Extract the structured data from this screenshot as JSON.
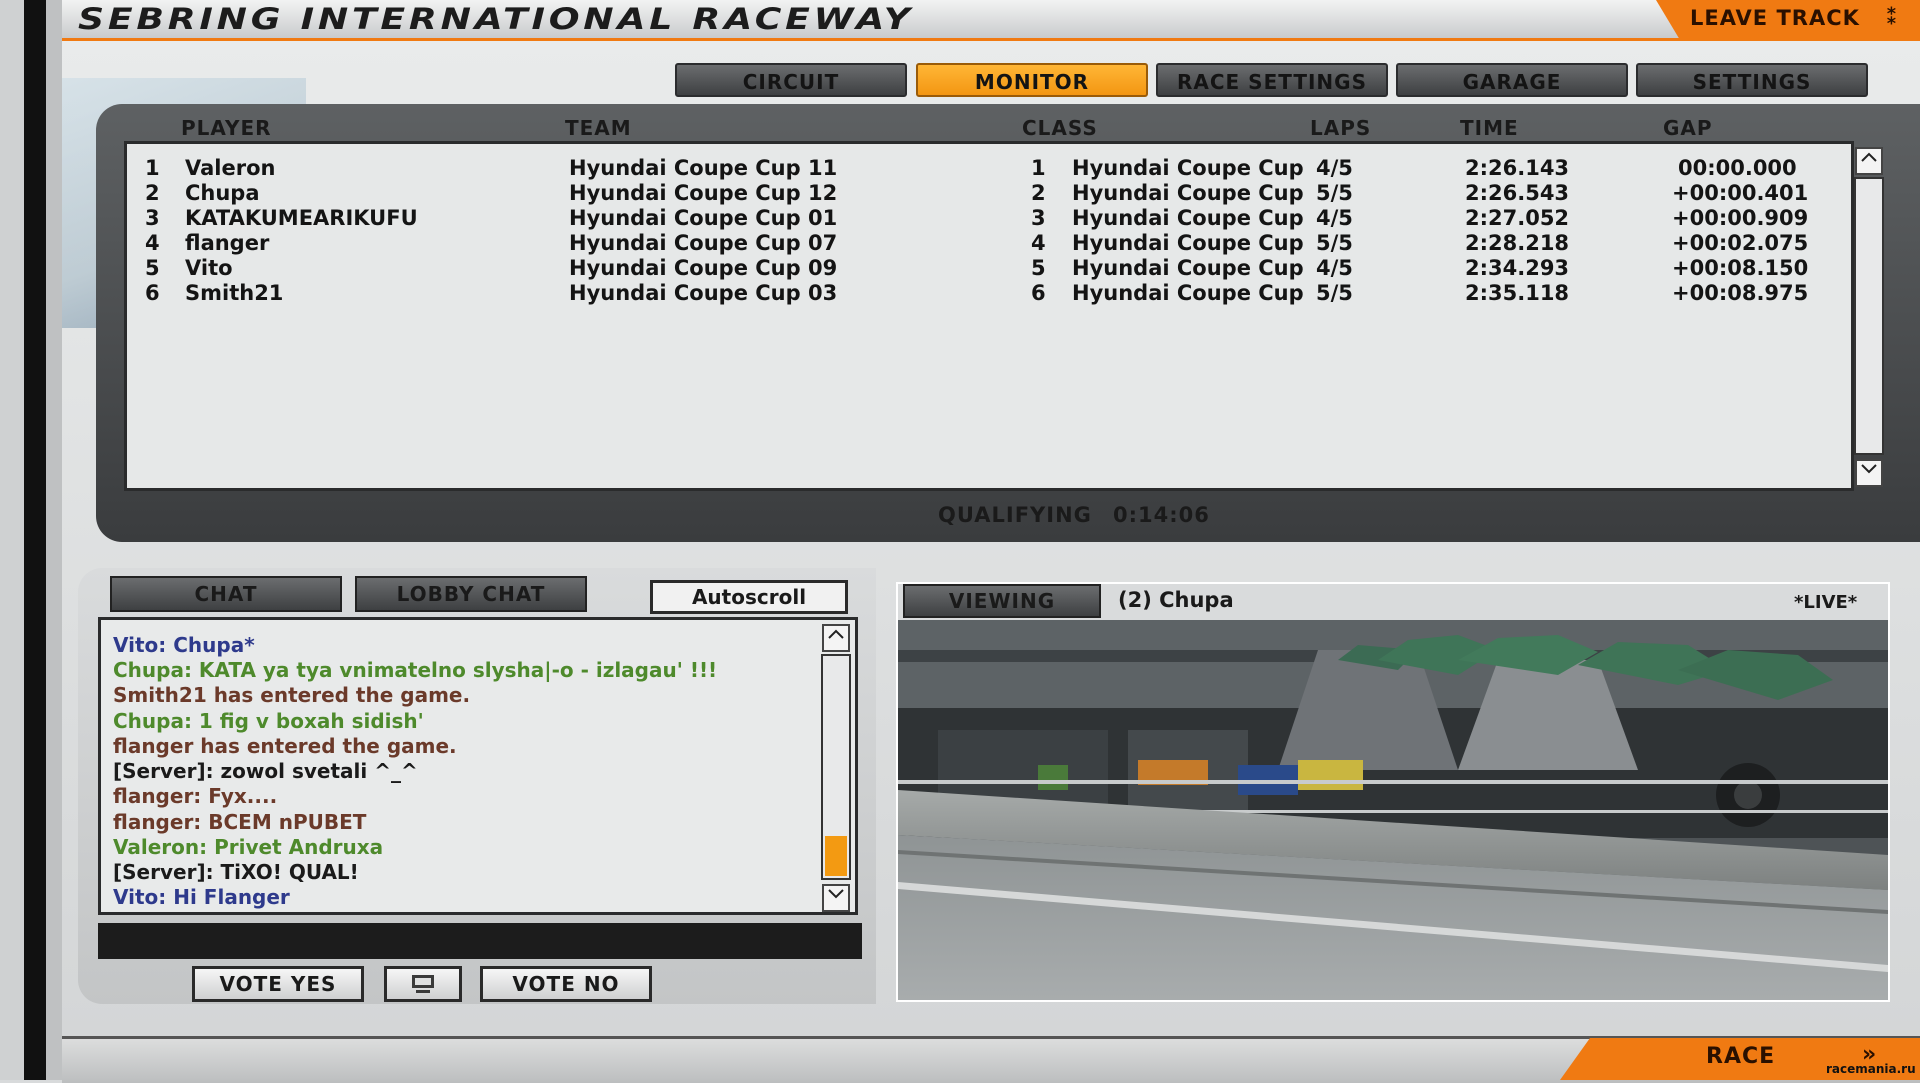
{
  "window": {
    "track_title": "SEBRING INTERNATIONAL RACEWAY",
    "leave_label": "LEAVE TRACK",
    "leave_icon": "checkered-flag-icon",
    "watermark": "racemania.ru"
  },
  "tabs": [
    {
      "label": "CIRCUIT",
      "active": false
    },
    {
      "label": "MONITOR",
      "active": true
    },
    {
      "label": "RACE SETTINGS",
      "active": false
    },
    {
      "label": "GARAGE",
      "active": false
    },
    {
      "label": "SETTINGS",
      "active": false
    }
  ],
  "standings": {
    "headers": {
      "player": "PLAYER",
      "team": "TEAM",
      "class": "CLASS",
      "laps": "LAPS",
      "time": "TIME",
      "gap": "GAP"
    },
    "rows": [
      {
        "pos": "1",
        "player": "Valeron",
        "team": "Hyundai Coupe Cup 11",
        "class_pos": "1",
        "class": "Hyundai Coupe Cup",
        "laps": "4/5",
        "time": "2:26.143",
        "gap": "00:00.000"
      },
      {
        "pos": "2",
        "player": "Chupa",
        "team": "Hyundai Coupe Cup 12",
        "class_pos": "2",
        "class": "Hyundai Coupe Cup",
        "laps": "5/5",
        "time": "2:26.543",
        "gap": "+00:00.401"
      },
      {
        "pos": "3",
        "player": "KATAKUMEARIKUFU",
        "team": "Hyundai Coupe Cup 01",
        "class_pos": "3",
        "class": "Hyundai Coupe Cup",
        "laps": "4/5",
        "time": "2:27.052",
        "gap": "+00:00.909"
      },
      {
        "pos": "4",
        "player": "flanger",
        "team": "Hyundai Coupe Cup 07",
        "class_pos": "4",
        "class": "Hyundai Coupe Cup",
        "laps": "5/5",
        "time": "2:28.218",
        "gap": "+00:02.075"
      },
      {
        "pos": "5",
        "player": "Vito",
        "team": "Hyundai Coupe Cup 09",
        "class_pos": "5",
        "class": "Hyundai Coupe Cup",
        "laps": "4/5",
        "time": "2:34.293",
        "gap": "+00:08.150"
      },
      {
        "pos": "6",
        "player": "Smith21",
        "team": "Hyundai Coupe Cup 03",
        "class_pos": "6",
        "class": "Hyundai Coupe Cup",
        "laps": "5/5",
        "time": "2:35.118",
        "gap": "+00:08.975"
      }
    ]
  },
  "session": {
    "label": "QUALIFYING",
    "time": "0:14:06"
  },
  "chat": {
    "tabs": {
      "chat": "CHAT",
      "lobby": "LOBBY CHAT"
    },
    "autoscroll_label": "Autoscroll",
    "scroll_level_percent": 18,
    "messages": [
      {
        "text": "Vito: Chupa*",
        "color": "#2e3a8c"
      },
      {
        "text": "Chupa: KATA ya tya vnimatelno slysha|-o - izlagau' !!!",
        "color": "#4e8a2c"
      },
      {
        "text": "Smith21 has entered the game.",
        "color": "#6b3a2a"
      },
      {
        "text": "Chupa: 1 fig v boxah sidish'",
        "color": "#4e8a2c"
      },
      {
        "text": "flanger has entered the game.",
        "color": "#6b3a2a"
      },
      {
        "text": "[Server]: zowol svetali ^_^",
        "color": "#1a1a1a"
      },
      {
        "text": "flanger: Fyx....",
        "color": "#6b3a2a"
      },
      {
        "text": "flanger: BCEM nPUBET",
        "color": "#6b3a2a"
      },
      {
        "text": "Valeron: Privet Andruxa",
        "color": "#4e8a2c"
      },
      {
        "text": "[Server]: TiXO! QUAL!",
        "color": "#1a1a1a"
      },
      {
        "text": "Vito: Hi Flanger",
        "color": "#2e3a8c"
      }
    ],
    "input_value": ""
  },
  "vote": {
    "yes": "VOTE YES",
    "no": "VOTE NO",
    "middle_icon": "monitor-icon"
  },
  "viewer": {
    "button": "VIEWING",
    "target": "(2) Chupa",
    "live": "*LIVE*"
  },
  "bottom": {
    "race_label": "RACE",
    "race_icon": "checkered-flag-icon"
  },
  "colors": {
    "accent": "#f07a12",
    "tab_active": "#f7a024",
    "dark_panel": "#4a4c4e"
  }
}
